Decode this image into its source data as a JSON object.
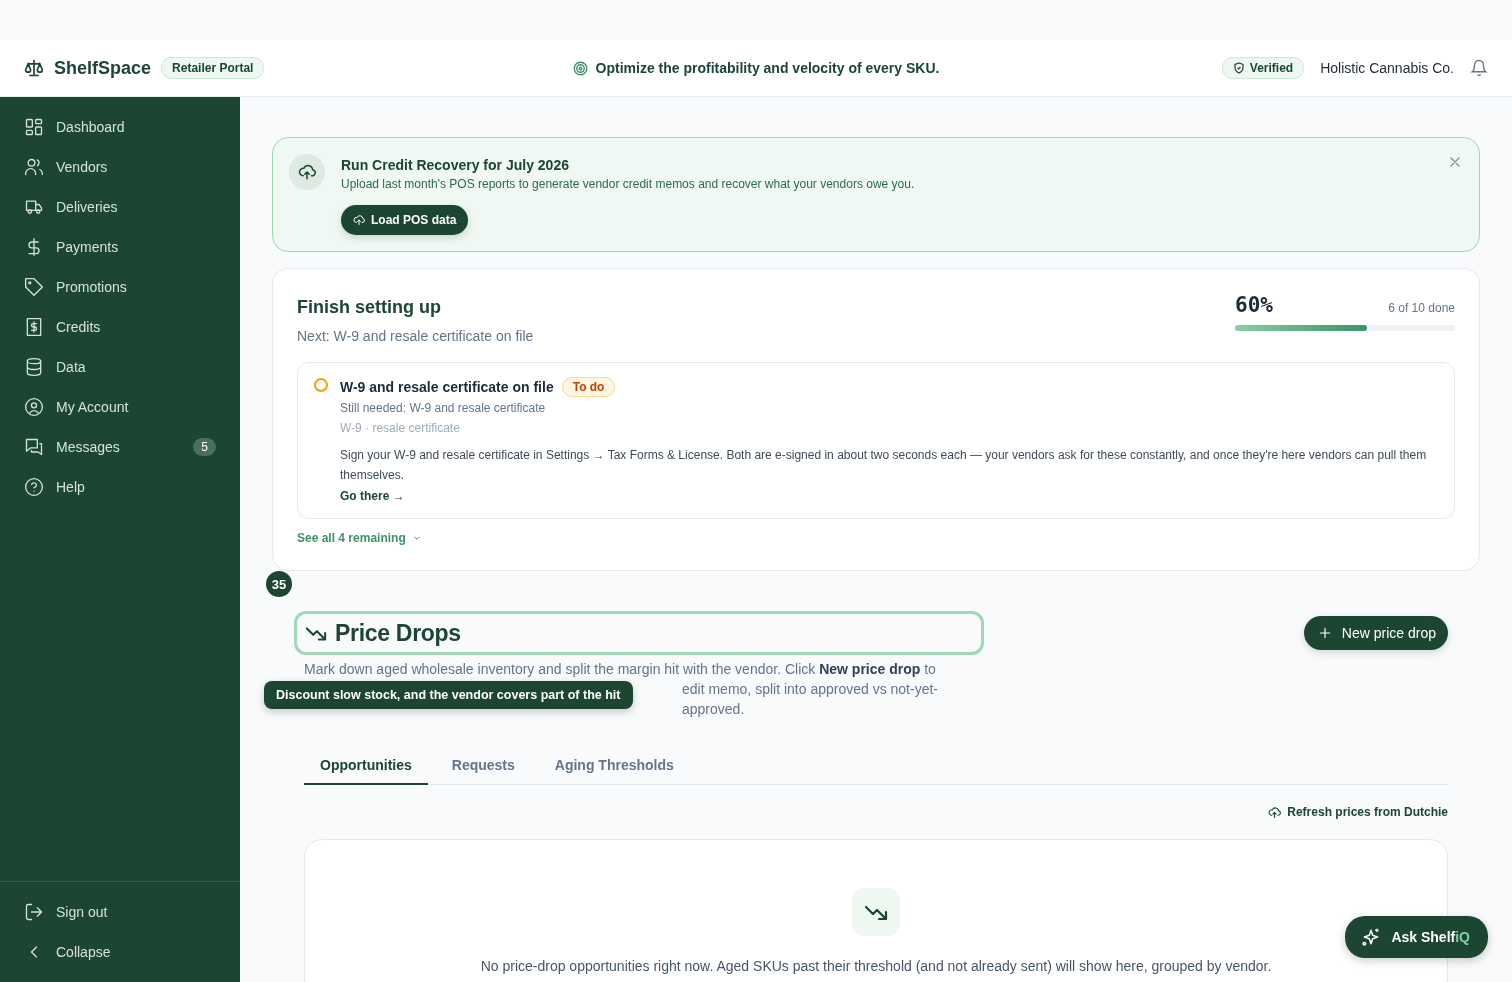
{
  "header": {
    "brand": "ShelfSpace",
    "portal_badge": "Retailer Portal",
    "tagline": "Optimize the profitability and velocity of every SKU.",
    "verified_badge": "Verified",
    "company": "Holistic Cannabis Co."
  },
  "sidebar": {
    "items": [
      {
        "label": "Dashboard",
        "selected": false
      },
      {
        "label": "Vendors",
        "selected": false
      },
      {
        "label": "Deliveries",
        "selected": false
      },
      {
        "label": "Payments",
        "selected": false
      },
      {
        "label": "Promotions",
        "selected": false
      },
      {
        "label": "Credits",
        "selected": false
      },
      {
        "label": "Data",
        "selected": false
      },
      {
        "label": "My Account",
        "selected": false
      },
      {
        "label": "Messages",
        "selected": false,
        "badge": "5"
      },
      {
        "label": "Help",
        "selected": false
      }
    ],
    "footer": [
      {
        "label": "Sign out"
      },
      {
        "label": "Collapse"
      }
    ]
  },
  "banner": {
    "title": "Run Credit Recovery for July 2026",
    "text": "Upload last month's POS reports to generate vendor credit memos and recover what your vendors owe you.",
    "button": "Load POS data"
  },
  "setup": {
    "title": "Finish setting up",
    "next": "Next: W-9 and resale certificate on file",
    "percent": "60%",
    "level": 0.6,
    "count": "6 of 10 done",
    "task": {
      "title": "W-9 and resale certificate on file",
      "checked": false,
      "status": "To do",
      "needed": "Still needed: W-9 and resale certificate",
      "tags": "W-9 · resale certificate",
      "text": "Sign your W-9 and resale certificate in Settings → Tax Forms & License. Both are e-signed in about two seconds each — your vendors ask for these constantly, and once they're here vendors can pull them themselves.",
      "link": "Go there →"
    },
    "see_all": "See all 4 remaining"
  },
  "price_drops": {
    "title": "Price Drops",
    "tour_step": "35",
    "tooltip": "Discount slow stock, and the vendor covers part of the hit",
    "description_line_1": "Mark down aged wholesale inventory and split the margin hit with the vendor. Click **New price drop** to",
    "description_rest": "edit memo, split into approved vs not-yet-approved.",
    "new_button": "New price drop",
    "tabs": [
      {
        "label": "Opportunities",
        "selected": true
      },
      {
        "label": "Requests",
        "selected": false
      },
      {
        "label": "Aging Thresholds",
        "selected": false
      }
    ],
    "refresh": "Refresh prices from Dutchie",
    "empty_text": "No price-drop opportunities right now. Aged SKUs past their threshold (and not already sent) will show here, grouped by vendor."
  },
  "assistant": {
    "label": "Ask Shelf",
    "label_accent": "iQ"
  }
}
